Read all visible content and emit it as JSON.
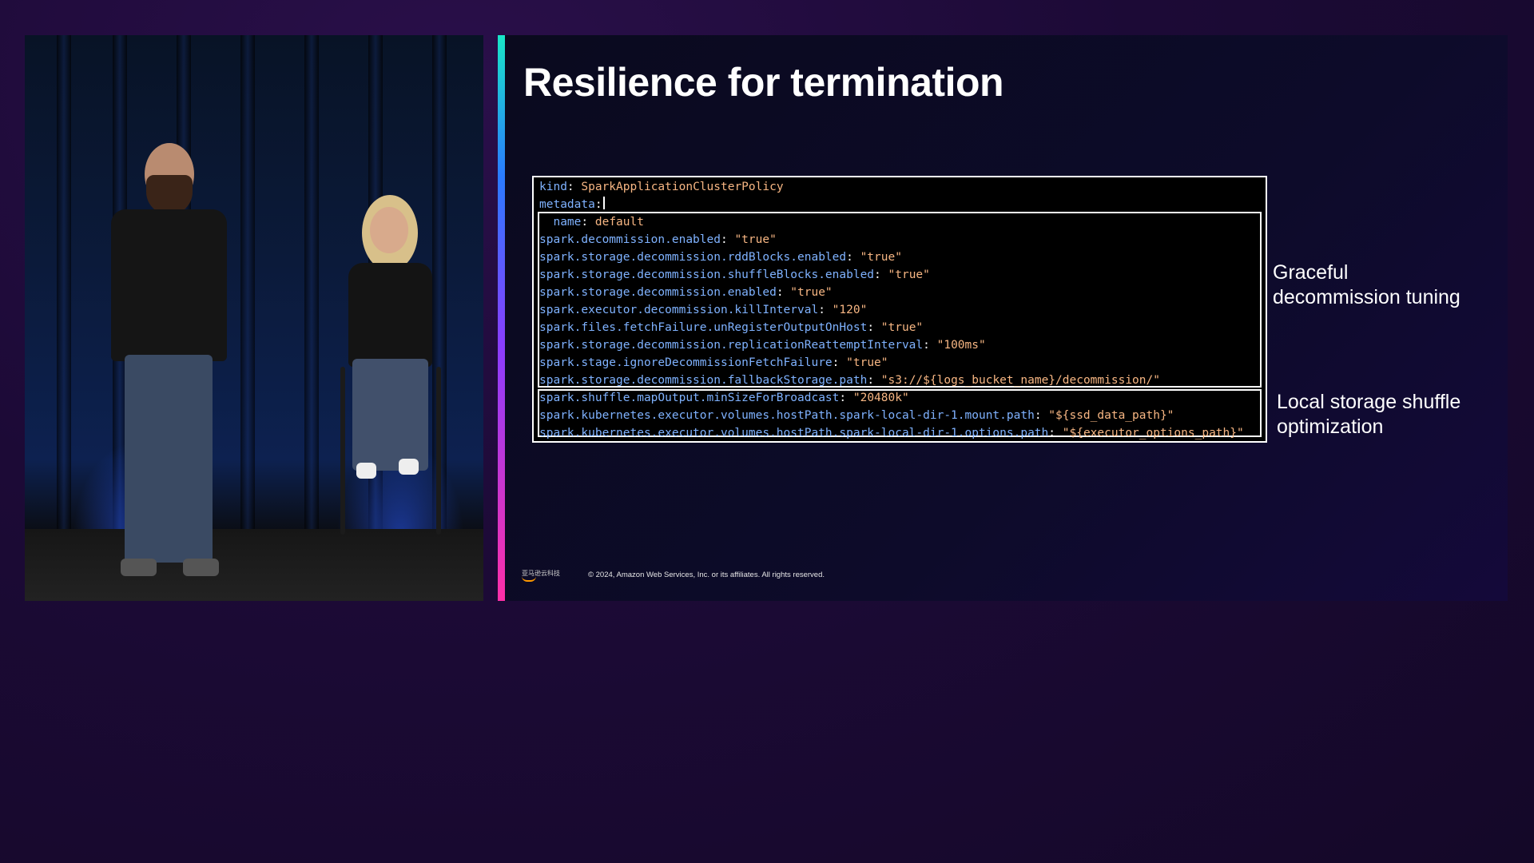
{
  "slide": {
    "title": "Resilience for termination",
    "code_lines": [
      {
        "key": "kind",
        "sep": ": ",
        "value": "SparkApplicationClusterPolicy"
      },
      {
        "key": "metadata",
        "sep": ":",
        "value": ""
      },
      {
        "key": "  name",
        "sep": ": ",
        "value": "default"
      },
      {
        "key": "spark.decommission.enabled",
        "sep": ": ",
        "value": "\"true\""
      },
      {
        "key": "spark.storage.decommission.rddBlocks.enabled",
        "sep": ": ",
        "value": "\"true\""
      },
      {
        "key": "spark.storage.decommission.shuffleBlocks.enabled",
        "sep": ": ",
        "value": "\"true\""
      },
      {
        "key": "spark.storage.decommission.enabled",
        "sep": ": ",
        "value": "\"true\""
      },
      {
        "key": "spark.executor.decommission.killInterval",
        "sep": ": ",
        "value": "\"120\""
      },
      {
        "key": "spark.files.fetchFailure.unRegisterOutputOnHost",
        "sep": ": ",
        "value": "\"true\""
      },
      {
        "key": "spark.storage.decommission.replicationReattemptInterval",
        "sep": ": ",
        "value": "\"100ms\""
      },
      {
        "key": "spark.stage.ignoreDecommissionFetchFailure",
        "sep": ": ",
        "value": "\"true\""
      },
      {
        "key": "spark.storage.decommission.fallbackStorage.path",
        "sep": ": ",
        "value": "\"s3://${logs_bucket_name}/decommission/\""
      },
      {
        "key": "spark.shuffle.mapOutput.minSizeForBroadcast",
        "sep": ": ",
        "value": "\"20480k\""
      },
      {
        "key": "spark.kubernetes.executor.volumes.hostPath.spark-local-dir-1.mount.path",
        "sep": ": ",
        "value": "\"${ssd_data_path}\""
      },
      {
        "key": "spark.kubernetes.executor.volumes.hostPath.spark-local-dir-1.options.path",
        "sep": ": ",
        "value": "\"${executor_options_path}\""
      }
    ],
    "annotations": {
      "graceful": "Graceful\ndecommission tuning",
      "local_storage": "Local storage shuffle\noptimization"
    },
    "footer": {
      "logo_text": "亚马逊云科技",
      "copyright": "© 2024, Amazon Web Services, Inc. or its affiliates. All rights reserved."
    }
  },
  "colors": {
    "code_key": "#7fb2ff",
    "code_value": "#f7b683",
    "accent_top": "#19e6c7",
    "accent_bottom": "#ff2fa8"
  }
}
